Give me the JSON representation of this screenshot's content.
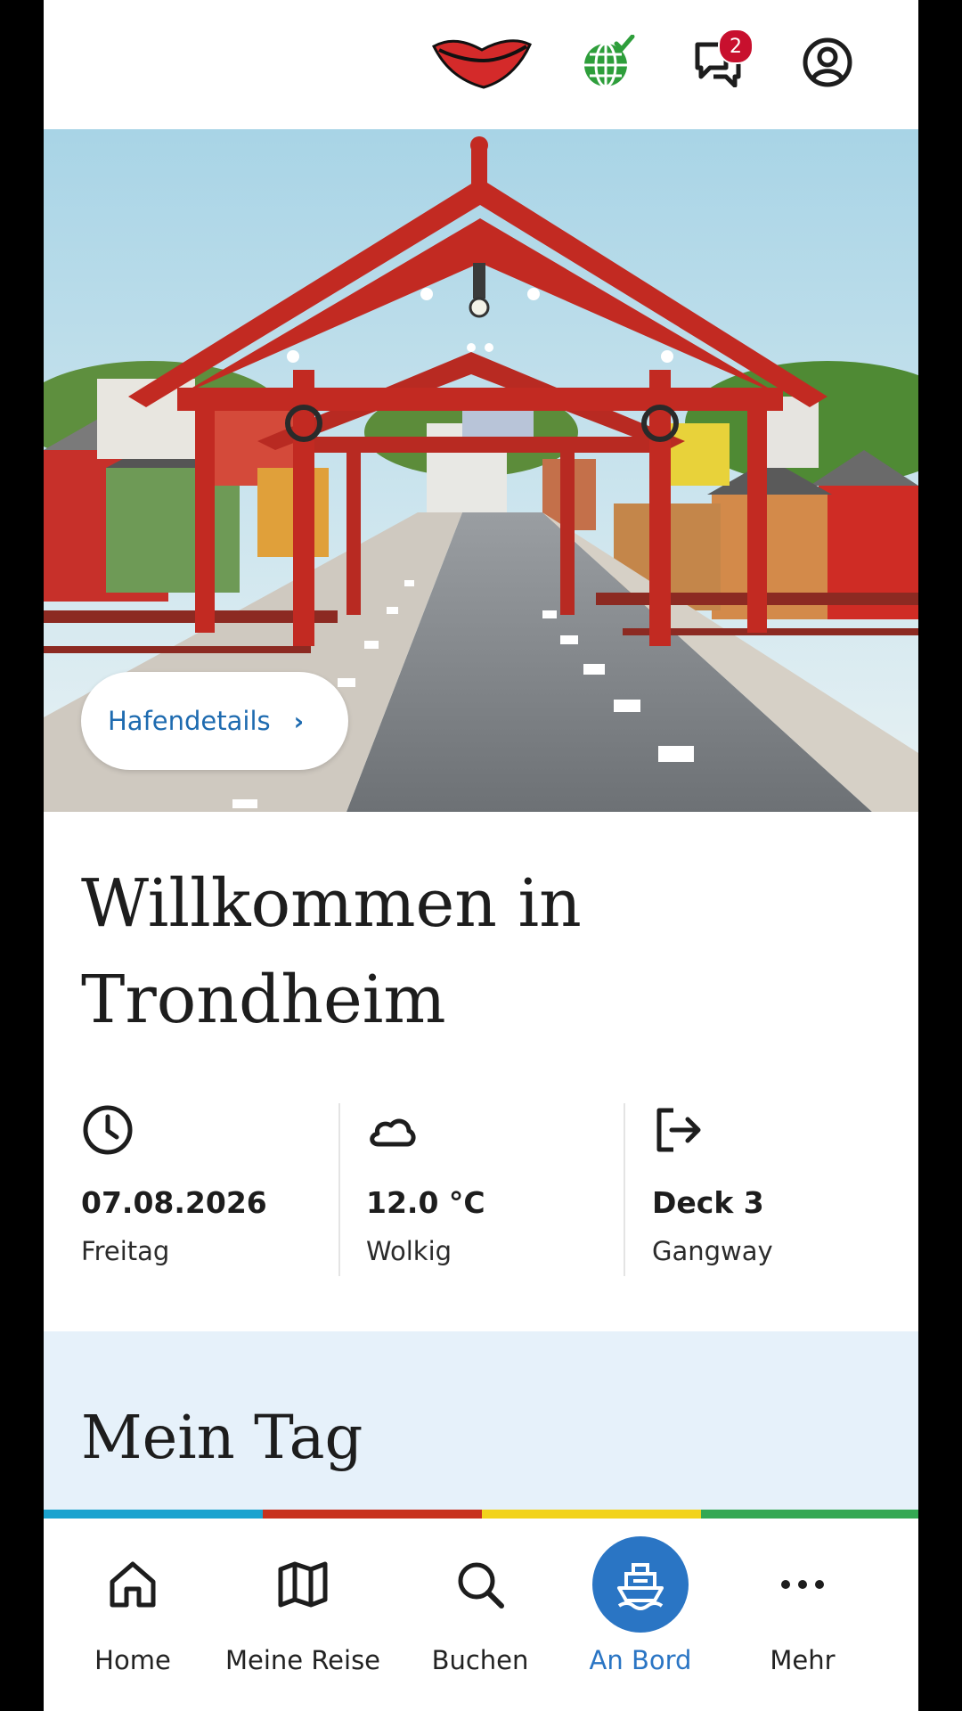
{
  "header": {
    "icons": [
      "lips-logo-icon",
      "globe-check-icon",
      "chat-icon",
      "account-icon"
    ],
    "notification_count": "2",
    "colors": {
      "logo": "#d42a2a",
      "globe": "#2e9e3b",
      "badge": "#c8102e"
    }
  },
  "hero": {
    "port_button_label": "Hafendetails",
    "port_button_chevron": "›"
  },
  "welcome": {
    "line1": "Willkommen in",
    "line2": "Trondheim"
  },
  "info": [
    {
      "icon": "clock-icon",
      "value": "07.08.2026",
      "label": "Freitag"
    },
    {
      "icon": "cloud-icon",
      "value": "12.0 °C",
      "label": "Wolkig"
    },
    {
      "icon": "exit-icon",
      "value": "Deck 3",
      "label": "Gangway"
    }
  ],
  "my_day": {
    "title": "Mein Tag"
  },
  "stripe_colors": [
    "#1ba3cf",
    "#c8321e",
    "#f2d31b",
    "#34a853"
  ],
  "nav": {
    "items": [
      {
        "icon": "home-icon",
        "label": "Home"
      },
      {
        "icon": "map-icon",
        "label": "Meine Reise"
      },
      {
        "icon": "search-icon",
        "label": "Buchen"
      },
      {
        "icon": "ship-icon",
        "label": "An Bord"
      },
      {
        "icon": "more-icon",
        "label": "Mehr"
      }
    ],
    "active": "An Bord",
    "accent": "#2a75c4"
  }
}
